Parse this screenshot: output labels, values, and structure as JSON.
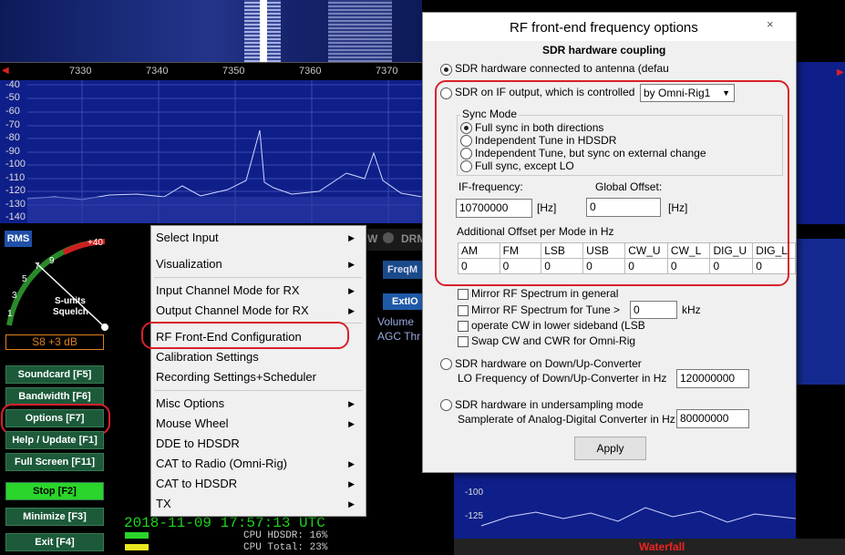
{
  "waterfall_top": {
    "freq_labels": [
      "7330",
      "7340",
      "7350",
      "7360",
      "7370"
    ]
  },
  "spectrum": {
    "db_labels": [
      "-40",
      "-50",
      "-60",
      "-70",
      "-80",
      "-90",
      "-100",
      "-110",
      "-120",
      "-130",
      "-140"
    ]
  },
  "smeter": {
    "mode": "RMS",
    "plus40": "+40",
    "nine": "9",
    "seven": "7",
    "five": "5",
    "three": "3",
    "one": "1",
    "units_label": "S-units",
    "squelch_label": "Squelch",
    "reading": "S8 +3 dB"
  },
  "left_buttons": {
    "soundcard": "Soundcard  [F5]",
    "bandwidth": "Bandwidth  [F6]",
    "options": "Options     [F7]",
    "help": "Help / Update  [F1]",
    "fullscreen": "Full Screen  [F11]",
    "stop": "Stop          [F2]",
    "minimize": "Minimize   [F3]",
    "exit": "Exit           [F4]"
  },
  "context_menu": {
    "items": [
      "Select Input",
      "Visualization",
      "Input Channel Mode for RX",
      "Output Channel Mode for RX",
      "RF Front-End Configuration",
      "Calibration Settings",
      "Recording Settings+Scheduler",
      "Misc Options",
      "Mouse Wheel",
      "DDE to HDSDR",
      "CAT to Radio (Omni-Rig)",
      "CAT to HDSDR",
      "TX"
    ]
  },
  "status": {
    "datetime": "2018-11-09  17:57:13 UTC",
    "cpu_hdsdr": "CPU HDSDR: 16%",
    "cpu_total": "CPU Total: 23%"
  },
  "background_partial": {
    "freqm": "FreqM",
    "extio": "ExtIO",
    "volume": "Volume",
    "agc": "AGC Thr",
    "w_label": "W",
    "drm": "DRM",
    "waterfall": "Waterfall",
    "db100": "-100",
    "db125": "-125"
  },
  "dialog": {
    "title": "RF front-end frequency options",
    "close": "×",
    "section_title": "SDR hardware coupling",
    "opt_antenna": "SDR hardware connected to antenna (defau",
    "opt_if": "SDR on IF output, which is controlled",
    "if_select": "by Omni-Rig1",
    "sync_mode_label": "Sync Mode",
    "sync_full": "Full sync in both directions",
    "sync_indep": "Independent Tune in HDSDR",
    "sync_indep_ext": "Independent Tune, but sync on external change",
    "sync_except_lo": "Full sync, except LO",
    "if_freq_label": "IF-frequency:",
    "if_freq_value": "10700000",
    "hz_unit": "[Hz]",
    "global_offset_label": "Global Offset:",
    "global_offset_value": "0",
    "hz_unit2": "[Hz]",
    "additional_offset_label": "Additional Offset per Mode in Hz",
    "modes": [
      "AM",
      "FM",
      "LSB",
      "USB",
      "CW_U",
      "CW_L",
      "DIG_U",
      "DIG_L"
    ],
    "mode_values": [
      "0",
      "0",
      "0",
      "0",
      "0",
      "0",
      "0",
      "0"
    ],
    "mirror_general": "Mirror RF Spectrum in general",
    "mirror_tune": "Mirror RF Spectrum for Tune >",
    "mirror_tune_value": "0",
    "khz": "kHz",
    "cw_lower": "operate CW in lower sideband (LSB",
    "swap_cw": "Swap CW and CWR for Omni-Rig",
    "opt_converter": "SDR hardware on Down/Up-Converter",
    "lo_freq_label": "LO Frequency of  Down/Up-Converter in Hz",
    "lo_freq_value": "120000000",
    "opt_undersampling": "SDR hardware in undersampling mode",
    "adc_label": "Samplerate of Analog-Digital Converter in Hz",
    "adc_value": "80000000",
    "apply": "Apply"
  }
}
